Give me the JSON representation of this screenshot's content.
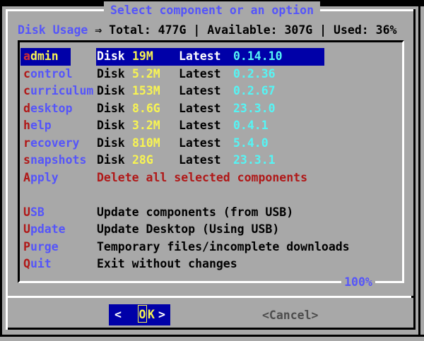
{
  "window": {
    "title": "Select component or an option",
    "summary": {
      "label": "Disk Usage",
      "text": "⇒ Total: 477G | Available: 307G | Used: 36%"
    }
  },
  "menu": {
    "disk_label": "Disk",
    "latest_label": "Latest",
    "scroll_position": "100%",
    "items": [
      {
        "tag": "admin",
        "size": "19M",
        "version": "0.14.10",
        "selected": true
      },
      {
        "tag": "control",
        "size": "5.2M",
        "version": "0.2.36"
      },
      {
        "tag": "curriculum",
        "size": "153M",
        "version": "0.2.67"
      },
      {
        "tag": "desktop",
        "size": "8.6G",
        "version": "23.3.0"
      },
      {
        "tag": "help",
        "size": "3.2M",
        "version": "0.4.1"
      },
      {
        "tag": "recovery",
        "size": "810M",
        "version": "5.4.0"
      },
      {
        "tag": "snapshots",
        "size": "28G",
        "version": "23.3.1"
      },
      {
        "tag": "Apply",
        "description": "Delete all selected components",
        "description_color": "red"
      },
      {
        "type": "spacer"
      },
      {
        "tag": "USB",
        "description": "Update components (from USB)"
      },
      {
        "tag": "Update",
        "description": "Update Desktop (Using USB)"
      },
      {
        "tag": "Purge",
        "description": "Temporary files/incomplete downloads"
      },
      {
        "tag": "Quit",
        "description": "Exit without changes"
      }
    ]
  },
  "buttons": {
    "ok_left_arrow": "<",
    "ok_label": "OK",
    "ok_right_arrow": ">",
    "cancel_label": "<Cancel>"
  },
  "colors": {
    "background": "#a8a8a8",
    "frame_black": "#000000",
    "border_light": "#ffffff",
    "highlight_bar": "#0000a8",
    "button_blue": "#0000a8",
    "accent_blue": "#5555fa",
    "hotkey_red": "#b01818",
    "size_yellow": "#f8f452",
    "version_cyan": "#55f5f5",
    "cancel_gray": "#4d4d4d"
  }
}
